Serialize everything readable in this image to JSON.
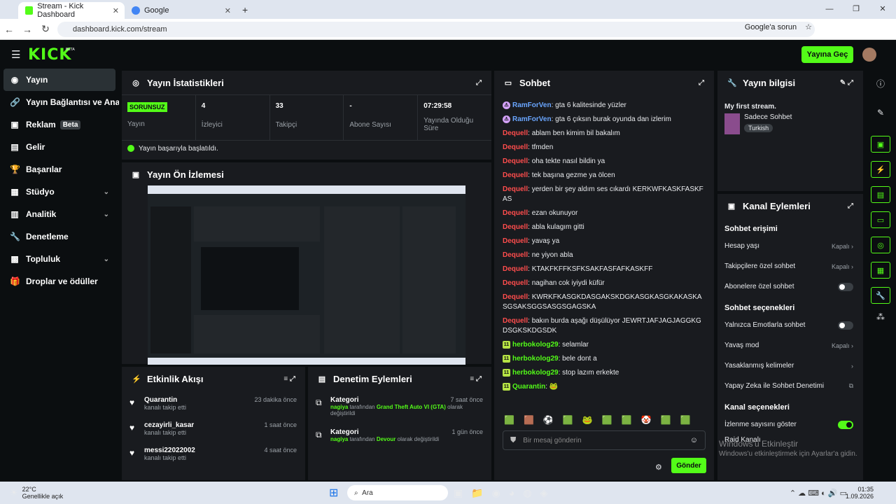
{
  "browser": {
    "tab1": "Stream - Kick Dashboard",
    "tab2": "Google",
    "url": "dashboard.kick.com/stream",
    "ask_google": "Google'a sorun"
  },
  "brand": {
    "logo": "KICK",
    "beta": "BETA",
    "go_live": "Yayına Geç"
  },
  "sidebar": {
    "items": [
      {
        "label": "Yayın",
        "icon": "broadcast-icon"
      },
      {
        "label": "Yayın Bağlantısı ve Anahtarı",
        "icon": "link-icon"
      },
      {
        "label": "Reklam",
        "icon": "ad-icon",
        "badge": "Beta"
      },
      {
        "label": "Gelir",
        "icon": "wallet-icon"
      },
      {
        "label": "Başarılar",
        "icon": "trophy-icon"
      },
      {
        "label": "Stüdyo",
        "icon": "studio-icon"
      },
      {
        "label": "Analitik",
        "icon": "analytics-icon"
      },
      {
        "label": "Denetleme",
        "icon": "wrench-icon"
      },
      {
        "label": "Topluluk",
        "icon": "community-icon"
      },
      {
        "label": "Droplar ve ödüller",
        "icon": "gift-icon"
      }
    ]
  },
  "stats": {
    "title": "Yayın İstatistikleri",
    "status": "SORUNSUZ",
    "status_label": "Yayın",
    "viewers": "4",
    "viewers_label": "İzleyici",
    "followers": "33",
    "followers_label": "Takipçi",
    "subs": "-",
    "subs_label": "Abone Sayısı",
    "duration": "07:29:58",
    "duration_label": "Yayında Olduğu Süre",
    "ok_message": "Yayın başarıyla başlatıldı."
  },
  "preview": {
    "title": "Yayın Ön İzlemesi"
  },
  "activity": {
    "title": "Etkinlik Akışı",
    "items": [
      {
        "name": "Quarantin",
        "desc": "kanalı takip etti",
        "time": "23 dakika önce"
      },
      {
        "name": "cezayirli_kasar",
        "desc": "kanalı takip etti",
        "time": "1 saat önce"
      },
      {
        "name": "messi22022002",
        "desc": "kanalı takip etti",
        "time": "4 saat önce"
      }
    ]
  },
  "moderation": {
    "title": "Denetim Eylemleri",
    "items": [
      {
        "title": "Kategori",
        "user": "nagiya",
        "mid": " tarafından ",
        "game": "Grand Theft Auto VI (GTA)",
        "tail": " olarak değiştirildi",
        "time": "7 saat önce"
      },
      {
        "title": "Kategori",
        "user": "nagiya",
        "mid": " tarafından ",
        "game": "Devour",
        "tail": " olarak değiştirildi",
        "time": "1 gün önce"
      }
    ]
  },
  "chat": {
    "title": "Sohbet",
    "messages": [
      {
        "user": "RamForVen",
        "color": "blue",
        "text": "gta 6 kalitesinde yüzler"
      },
      {
        "user": "RamForVen",
        "color": "blue",
        "text": "gta 6 çıksın burak oyunda dan izlerim"
      },
      {
        "user": "Dequell",
        "color": "red",
        "text": "ablam ben kimim bil bakalım"
      },
      {
        "user": "Dequell",
        "color": "red",
        "text": "tfmden"
      },
      {
        "user": "Dequell",
        "color": "red",
        "text": "oha tekte nasıl bildin ya"
      },
      {
        "user": "Dequell",
        "color": "red",
        "text": "tek başına gezme ya ölcen"
      },
      {
        "user": "Dequell",
        "color": "red",
        "text": "yerden bir şey aldım ses cıkardı KERKWFKASKFASKFAS"
      },
      {
        "user": "Dequell",
        "color": "red",
        "text": "ezan okunuyor"
      },
      {
        "user": "Dequell",
        "color": "red",
        "text": "abla kulagım gitti"
      },
      {
        "user": "Dequell",
        "color": "red",
        "text": "yavaş ya"
      },
      {
        "user": "Dequell",
        "color": "red",
        "text": "ne yiyon abla"
      },
      {
        "user": "Dequell",
        "color": "red",
        "text": "KTAKFKFFKSFKSAKFASFAFKASKFF"
      },
      {
        "user": "Dequell",
        "color": "red",
        "text": "nagihan cok iyiydi küfür"
      },
      {
        "user": "Dequell",
        "color": "red",
        "text": "KWRKFKASGKDASGAKSKDGKASGKASGKAKASKASGSAKSGGSASGSGAGSKA"
      },
      {
        "user": "Dequell",
        "color": "red",
        "text": "bakın burda aşağı düşülüyor JEWRTJAFJAGJAGGKGDSGKSKDGSDK"
      },
      {
        "user": "herbokolog29",
        "color": "green",
        "text": "selamlar"
      },
      {
        "user": "herbokolog29",
        "color": "green",
        "text": "bele dont a"
      },
      {
        "user": "herbokolog29",
        "color": "green",
        "text": "stop lazım erkekte"
      },
      {
        "user": "Quarantin",
        "color": "green",
        "text": "🐸"
      }
    ],
    "placeholder": "Bir mesaj gönderin",
    "send": "Gönder"
  },
  "info": {
    "title": "Yayın bilgisi",
    "stream_title": "My first stream.",
    "category": "Sadece Sohbet",
    "tag": "Turkish"
  },
  "channel": {
    "title": "Kanal Eylemleri",
    "access_head": "Sohbet erişimi",
    "account_age": "Hesap yaşı",
    "account_age_val": "Kapalı",
    "followers_only": "Takipçilere özel sohbet",
    "followers_only_val": "Kapalı",
    "subs_only": "Abonelere özel sohbet",
    "options_head": "Sohbet seçenekleri",
    "emotes_only": "Yalnızca Emotlarla sohbet",
    "slow_mode": "Yavaş mod",
    "slow_mode_val": "Kapalı",
    "banned_words": "Yasaklanmış kelimeler",
    "ai_mod": "Yapay Zeka ile Sohbet Denetimi",
    "channel_head": "Kanal seçenekleri",
    "show_viewers": "İzlenme sayısını göster",
    "raid": "Raid Kanalı",
    "watermark1": "Windows'u Etkinleştir",
    "watermark2": "Windows'u etkinleştirmek için Ayarlar'a gidin."
  },
  "taskbar": {
    "weather": "22°C",
    "weather_desc": "Genellikle açık",
    "search": "Ara",
    "time": "01:35",
    "date": "1.09.2026"
  }
}
